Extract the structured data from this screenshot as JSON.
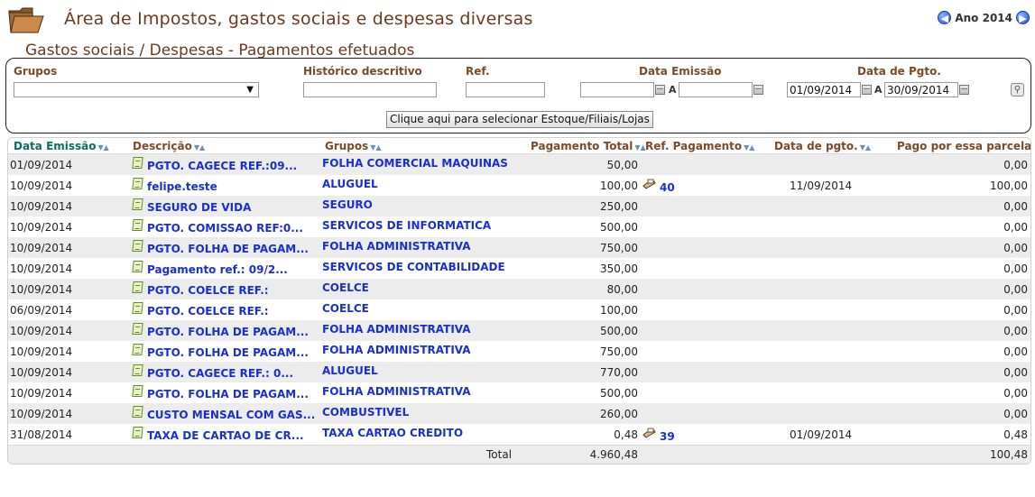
{
  "header": {
    "title": "Área de Impostos, gastos sociais e despesas diversas",
    "subtitle": "Gastos sociais / Despesas - Pagamentos efetuados",
    "year_label": "Ano 2014",
    "prev_icon": "arrow-left-icon",
    "next_icon": "arrow-right-icon"
  },
  "filters": {
    "grupos_label": "Grupos",
    "grupos_value": "",
    "historico_label": "Histórico descritivo",
    "historico_value": "",
    "ref_label": "Ref.",
    "ref_value": "",
    "data_emissao_label": "Data Emissão",
    "data_emissao_from": "",
    "data_emissao_to": "",
    "data_pgto_label": "Data de Pgto.",
    "data_pgto_from": "01/09/2014",
    "data_pgto_to": "30/09/2014",
    "range_sep": "A",
    "estoque_button": "Clique aqui para selecionar Estoque/Filiais/Lojas"
  },
  "table": {
    "columns": [
      "Data Emissão",
      "Descrição",
      "Grupos",
      "Pagamento Total",
      "Ref. Pagamento",
      "Data de pgto.",
      "Pago por essa parcela"
    ],
    "sort_glyph": "▼▲",
    "rows": [
      {
        "data": "01/09/2014",
        "descricao": "PGTO. CAGECE REF.:09...",
        "grupo": "FOLHA COMERCIAL MAQUINAS",
        "pagamento": "50,00",
        "ref": "",
        "data_pgto": "",
        "pago": "0,00"
      },
      {
        "data": "10/09/2014",
        "descricao": "felipe.teste",
        "grupo": "ALUGUEL",
        "pagamento": "100,00",
        "ref": "40",
        "data_pgto": "11/09/2014",
        "pago": "100,00"
      },
      {
        "data": "10/09/2014",
        "descricao": "SEGURO DE VIDA",
        "grupo": "SEGURO",
        "pagamento": "250,00",
        "ref": "",
        "data_pgto": "",
        "pago": "0,00"
      },
      {
        "data": "10/09/2014",
        "descricao": "PGTO. COMISSAO REF:0...",
        "grupo": "SERVICOS DE INFORMATICA",
        "pagamento": "500,00",
        "ref": "",
        "data_pgto": "",
        "pago": "0,00"
      },
      {
        "data": "10/09/2014",
        "descricao": "PGTO. FOLHA DE PAGAM...",
        "grupo": "FOLHA ADMINISTRATIVA",
        "pagamento": "750,00",
        "ref": "",
        "data_pgto": "",
        "pago": "0,00"
      },
      {
        "data": "10/09/2014",
        "descricao": "Pagamento ref.: 09/2...",
        "grupo": "SERVICOS DE CONTABILIDADE",
        "pagamento": "350,00",
        "ref": "",
        "data_pgto": "",
        "pago": "0,00"
      },
      {
        "data": "10/09/2014",
        "descricao": "PGTO. COELCE REF.:",
        "grupo": "COELCE",
        "pagamento": "80,00",
        "ref": "",
        "data_pgto": "",
        "pago": "0,00"
      },
      {
        "data": "06/09/2014",
        "descricao": "PGTO. COELCE REF.:",
        "grupo": "COELCE",
        "pagamento": "100,00",
        "ref": "",
        "data_pgto": "",
        "pago": "0,00"
      },
      {
        "data": "10/09/2014",
        "descricao": "PGTO. FOLHA DE PAGAM...",
        "grupo": "FOLHA ADMINISTRATIVA",
        "pagamento": "500,00",
        "ref": "",
        "data_pgto": "",
        "pago": "0,00"
      },
      {
        "data": "10/09/2014",
        "descricao": "PGTO. FOLHA DE PAGAM...",
        "grupo": "FOLHA ADMINISTRATIVA",
        "pagamento": "750,00",
        "ref": "",
        "data_pgto": "",
        "pago": "0,00"
      },
      {
        "data": "10/09/2014",
        "descricao": "PGTO. CAGECE REF.: 0...",
        "grupo": "ALUGUEL",
        "pagamento": "770,00",
        "ref": "",
        "data_pgto": "",
        "pago": "0,00"
      },
      {
        "data": "10/09/2014",
        "descricao": "PGTO. FOLHA DE PAGAM...",
        "grupo": "FOLHA ADMINISTRATIVA",
        "pagamento": "500,00",
        "ref": "",
        "data_pgto": "",
        "pago": "0,00"
      },
      {
        "data": "10/09/2014",
        "descricao": "CUSTO MENSAL COM GAS...",
        "grupo": "COMBUSTIVEL",
        "pagamento": "260,00",
        "ref": "",
        "data_pgto": "",
        "pago": "0,00"
      },
      {
        "data": "31/08/2014",
        "descricao": "TAXA DE CARTAO DE CR...",
        "grupo": "TAXA CARTAO CREDITO",
        "pagamento": "0,48",
        "ref": "39",
        "data_pgto": "01/09/2014",
        "pago": "0,48"
      }
    ],
    "total_label": "Total",
    "total_pagamento": "4.960,48",
    "total_pago": "100,48"
  }
}
